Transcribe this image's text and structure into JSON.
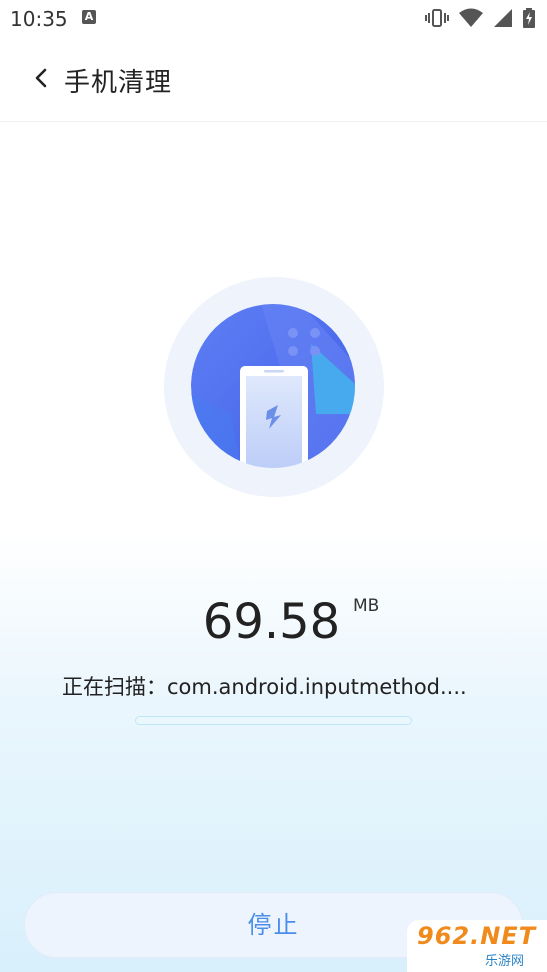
{
  "status_bar": {
    "time": "10:35",
    "notification_badge": "A"
  },
  "header": {
    "title": "手机清理"
  },
  "scan": {
    "size_value": "69.58",
    "size_unit": "MB",
    "status_text": "正在扫描：com.android.inputmethod....",
    "progress": 0
  },
  "actions": {
    "stop_label": "停止"
  },
  "watermark": {
    "brand": "962.NET",
    "sub": "乐游网"
  },
  "colors": {
    "accent": "#4a8ee8",
    "illustration_blue": "#4d6bf2",
    "progress_border": "#bfe6f7"
  }
}
